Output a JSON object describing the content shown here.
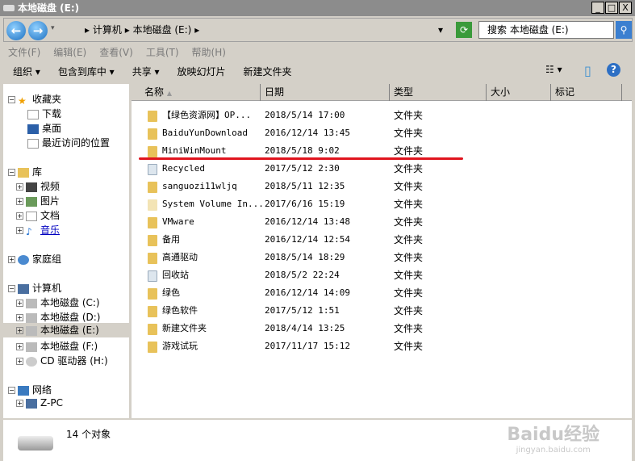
{
  "window": {
    "title": "本地磁盘 (E:)",
    "minimize": "_",
    "maximize": "□",
    "close": "X"
  },
  "address": {
    "back": "←",
    "forward": "→",
    "path": [
      "计算机",
      "本地磁盘 (E:)"
    ],
    "sep": "▸",
    "dropdown": "▾",
    "refresh": "⟳",
    "search_placeholder": "搜索 本地磁盘 (E:)",
    "search_icon": "⚲"
  },
  "menu": [
    "文件(F)",
    "编辑(E)",
    "查看(V)",
    "工具(T)",
    "帮助(H)"
  ],
  "toolbar": [
    "组织 ▾",
    "包含到库中 ▾",
    "共享 ▾",
    "放映幻灯片",
    "新建文件夹"
  ],
  "toolbar_right": {
    "views": "☷ ▾",
    "preview": "▯",
    "help": "?"
  },
  "sidebar": {
    "favorites": {
      "label": "收藏夹",
      "items": [
        "下载",
        "桌面",
        "最近访问的位置"
      ]
    },
    "libraries": {
      "label": "库",
      "items": [
        "视频",
        "图片",
        "文档",
        "音乐"
      ]
    },
    "homegroup": "家庭组",
    "computer": {
      "label": "计算机",
      "items": [
        "本地磁盘 (C:)",
        "本地磁盘 (D:)",
        "本地磁盘 (E:)",
        "本地磁盘 (F:)",
        "CD 驱动器 (H:)"
      ]
    },
    "network": {
      "label": "网络",
      "items": [
        "Z-PC"
      ]
    }
  },
  "columns": [
    "名称",
    "日期",
    "类型",
    "大小",
    "标记"
  ],
  "sort_arrow": "▲",
  "files": [
    {
      "name": "【绿色资源网】OP...",
      "date": "2018/5/14 17:00",
      "type": "文件夹",
      "icon": "folder"
    },
    {
      "name": "BaiduYunDownload",
      "date": "2016/12/14 13:45",
      "type": "文件夹",
      "icon": "folder"
    },
    {
      "name": "MiniWinMount",
      "date": "2018/5/18 9:02",
      "type": "文件夹",
      "icon": "folder"
    },
    {
      "name": "Recycled",
      "date": "2017/5/12 2:30",
      "type": "文件夹",
      "icon": "recycle"
    },
    {
      "name": "sanguozi11wljq",
      "date": "2018/5/11 12:35",
      "type": "文件夹",
      "icon": "folder"
    },
    {
      "name": "System Volume In...",
      "date": "2017/6/16 15:19",
      "type": "文件夹",
      "icon": "system"
    },
    {
      "name": "VMware",
      "date": "2016/12/14 13:48",
      "type": "文件夹",
      "icon": "folder"
    },
    {
      "name": "备用",
      "date": "2016/12/14 12:54",
      "type": "文件夹",
      "icon": "folder"
    },
    {
      "name": "高通驱动",
      "date": "2018/5/14 18:29",
      "type": "文件夹",
      "icon": "folder"
    },
    {
      "name": "回收站",
      "date": "2018/5/2 22:24",
      "type": "文件夹",
      "icon": "recycle"
    },
    {
      "name": "绿色",
      "date": "2016/12/14 14:09",
      "type": "文件夹",
      "icon": "folder"
    },
    {
      "name": "绿色软件",
      "date": "2017/5/12 1:51",
      "type": "文件夹",
      "icon": "folder"
    },
    {
      "name": "新建文件夹",
      "date": "2018/4/14 13:25",
      "type": "文件夹",
      "icon": "folder"
    },
    {
      "name": "游戏试玩",
      "date": "2017/11/17 15:12",
      "type": "文件夹",
      "icon": "folder"
    }
  ],
  "status": {
    "count": "14 个对象"
  },
  "watermark": {
    "brand": "Baidu经验",
    "url": "jingyan.baidu.com"
  },
  "colors": {
    "highlight_line": "#e0141e"
  }
}
